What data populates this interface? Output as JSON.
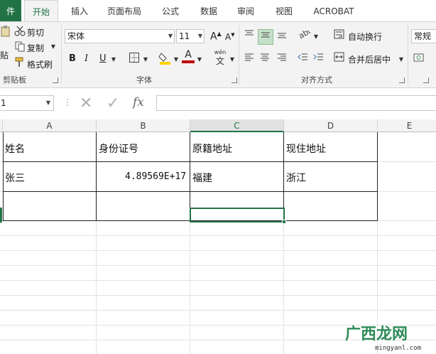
{
  "tabs": {
    "file": "件",
    "home": "开始",
    "insert": "插入",
    "layout": "页面布局",
    "formulas": "公式",
    "data": "数据",
    "review": "审阅",
    "view": "视图",
    "acrobat": "ACROBAT"
  },
  "clipboard": {
    "cut": "剪切",
    "copy": "复制",
    "paste_partial": "贴",
    "format_painter": "格式刷",
    "label": "剪贴板"
  },
  "font": {
    "name": "宋体",
    "size": "11",
    "bold": "B",
    "italic": "I",
    "underline": "U",
    "grow": "A",
    "shrink": "A",
    "phonetic_top": "wén",
    "phonetic_bottom": "文",
    "font_color_letter": "A",
    "label": "字体"
  },
  "alignment": {
    "wrap_text": "自动换行",
    "merge_center": "合并后居中",
    "label": "对齐方式"
  },
  "number": {
    "format": "常规"
  },
  "formula_bar": {
    "name_box": "1",
    "fx": "fx",
    "cancel": "✕",
    "enter": "✓"
  },
  "columns": [
    "A",
    "B",
    "C",
    "D",
    "E"
  ],
  "table": {
    "headers": [
      "姓名",
      "身份证号",
      "原籍地址",
      "现住地址"
    ],
    "row1": [
      "张三",
      "4.89569E+17",
      "福建",
      "浙江"
    ]
  },
  "watermark": {
    "brand": "广西龙网",
    "domain": "mingyanl.com"
  },
  "colors": {
    "accent": "#217346",
    "ribbon_bg": "#f3f3f3",
    "font_color_bar": "#c00000",
    "highlight_bar": "#ffd200"
  }
}
